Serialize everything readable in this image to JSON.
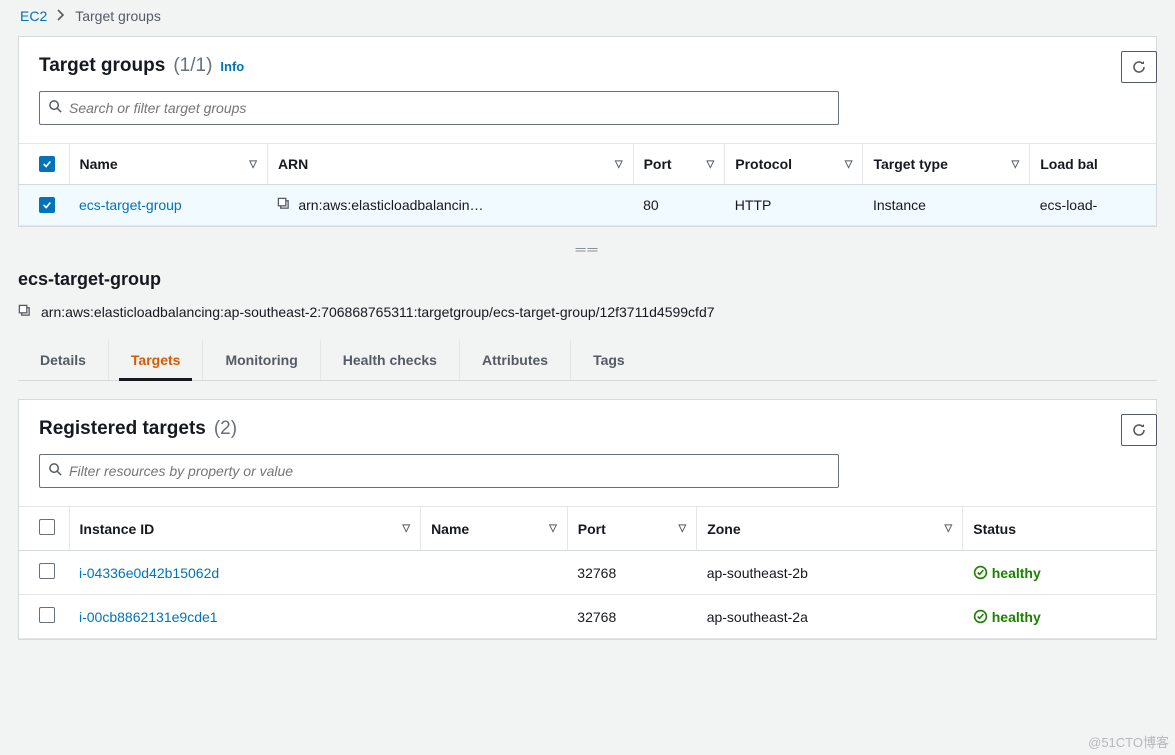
{
  "breadcrumb": {
    "root": "EC2",
    "current": "Target groups"
  },
  "target_groups_panel": {
    "title": "Target groups",
    "count_label": "(1/1)",
    "info_label": "Info",
    "search_placeholder": "Search or filter target groups",
    "columns": {
      "name": "Name",
      "arn": "ARN",
      "port": "Port",
      "protocol": "Protocol",
      "target_type": "Target type",
      "lb": "Load bal"
    },
    "rows": [
      {
        "name": "ecs-target-group",
        "arn": "arn:aws:elasticloadbalancin…",
        "port": "80",
        "protocol": "HTTP",
        "target_type": "Instance",
        "lb": "ecs-load-",
        "selected": true
      }
    ]
  },
  "detail": {
    "title": "ecs-target-group",
    "arn": "arn:aws:elasticloadbalancing:ap-southeast-2:706868765311:targetgroup/ecs-target-group/12f3711d4599cfd7"
  },
  "tabs": {
    "details": "Details",
    "targets": "Targets",
    "monitoring": "Monitoring",
    "health_checks": "Health checks",
    "attributes": "Attributes",
    "tags": "Tags",
    "active": "targets"
  },
  "registered_targets": {
    "title": "Registered targets",
    "count_label": "(2)",
    "search_placeholder": "Filter resources by property or value",
    "columns": {
      "instance_id": "Instance ID",
      "name": "Name",
      "port": "Port",
      "zone": "Zone",
      "status": "Status"
    },
    "rows": [
      {
        "instance_id": "i-04336e0d42b15062d",
        "name": "",
        "port": "32768",
        "zone": "ap-southeast-2b",
        "status": "healthy"
      },
      {
        "instance_id": "i-00cb8862131e9cde1",
        "name": "",
        "port": "32768",
        "zone": "ap-southeast-2a",
        "status": "healthy"
      }
    ]
  },
  "watermark": "@51CTO博客"
}
